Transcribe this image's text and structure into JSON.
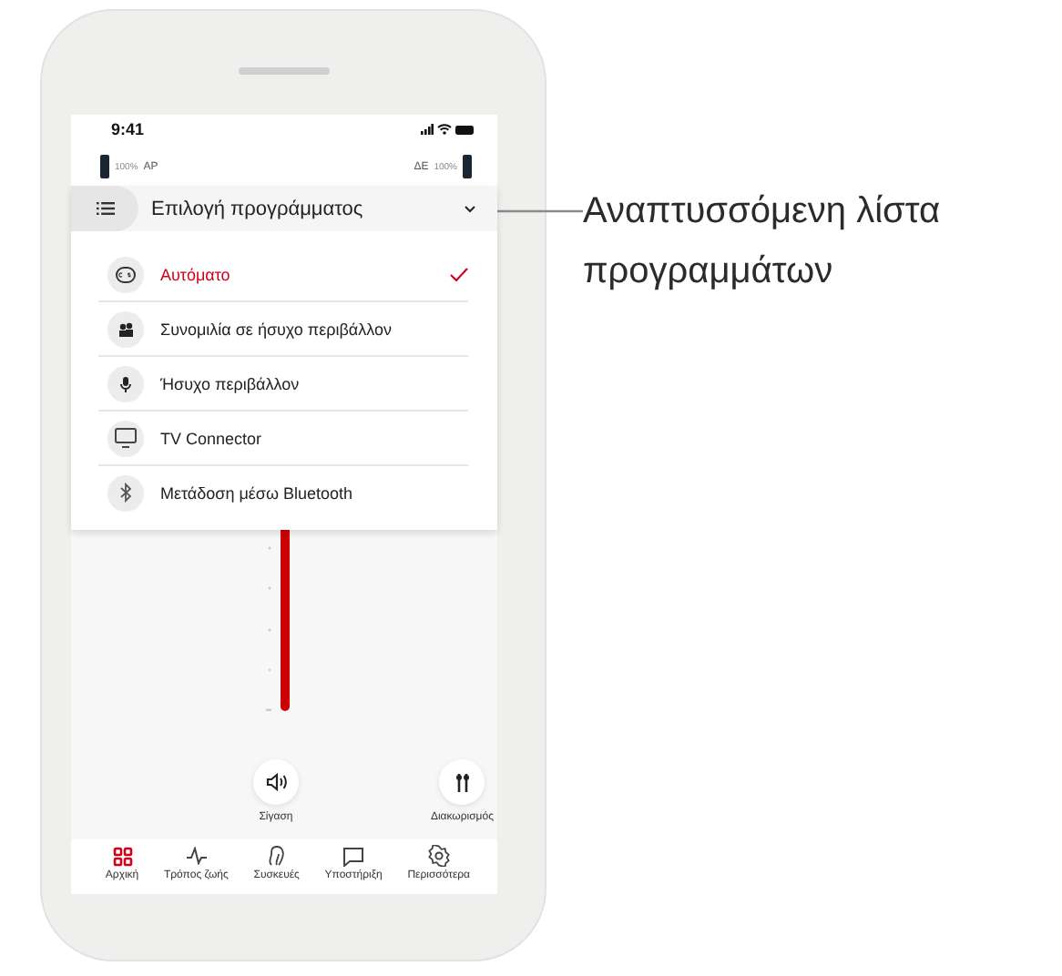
{
  "status_bar": {
    "time": "9:41"
  },
  "hearing_aids": {
    "left": {
      "battery": "100%",
      "side": "ΑΡ"
    },
    "right": {
      "side": "ΔΕ",
      "battery": "100%"
    }
  },
  "program_dropdown": {
    "title": "Επιλογή προγράμματος",
    "expanded": true,
    "items": [
      {
        "label": "Αυτόματο",
        "kind": "auto",
        "selected": true
      },
      {
        "label": "Συνομιλία σε ήσυχο περιβάλλον",
        "kind": "conversation",
        "selected": false
      },
      {
        "label": "Ήσυχο περιβάλλον",
        "kind": "quiet",
        "selected": false
      },
      {
        "label": "TV Connector",
        "kind": "tv",
        "selected": false
      },
      {
        "label": "Μετάδοση μέσω Bluetooth",
        "kind": "bluetooth",
        "selected": false
      }
    ]
  },
  "actions": [
    {
      "label": "Σίγαση",
      "kind": "mute"
    },
    {
      "label": "Διακωρισμός",
      "kind": "split"
    }
  ],
  "tabs": [
    {
      "label": "Αρχική",
      "kind": "home",
      "selected": true
    },
    {
      "label": "Τρόπος ζωής",
      "kind": "lifestyle",
      "selected": false
    },
    {
      "label": "Συσκευές",
      "kind": "devices",
      "selected": false
    },
    {
      "label": "Υποστήριξη",
      "kind": "support",
      "selected": false
    },
    {
      "label": "Περισσότερα",
      "kind": "more",
      "selected": false
    }
  ],
  "callout": {
    "text": "Αναπτυσσόμενη λίστα προγραμμάτων"
  }
}
